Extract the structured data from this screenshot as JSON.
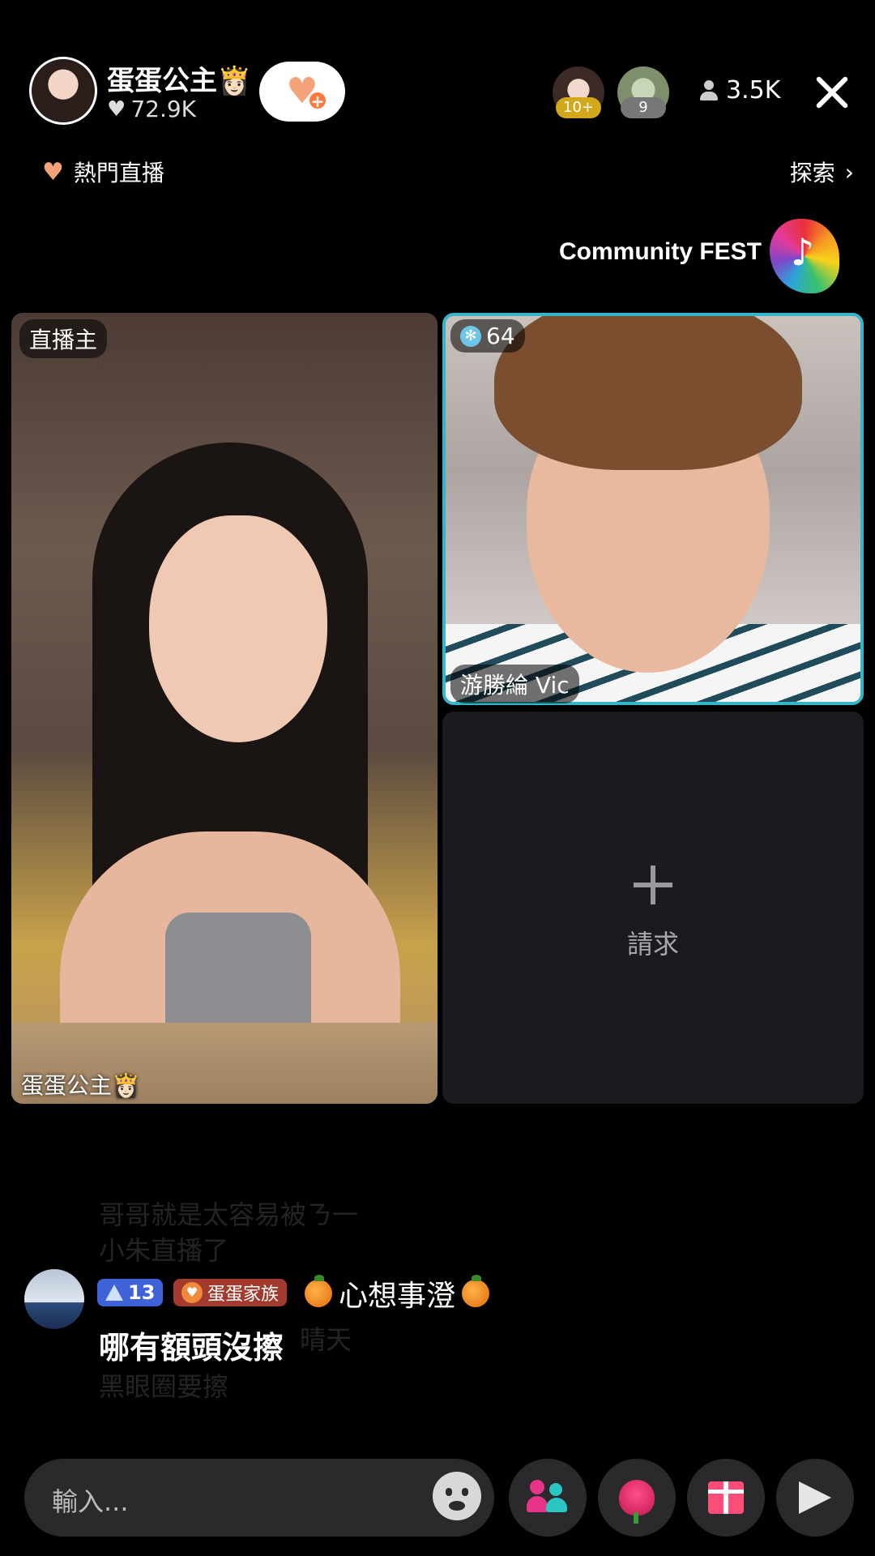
{
  "header": {
    "host_name": "蛋蛋公主👸🏻",
    "host_likes": "72.9K",
    "viewer_badges": [
      "10+",
      "9"
    ],
    "viewer_count": "3.5K"
  },
  "subbar": {
    "hot_live_label": "熱門直播",
    "explore_label": "探索"
  },
  "event_banner": {
    "title": "Community FEST"
  },
  "tiles": {
    "host_role": "直播主",
    "host_name": "蛋蛋公主👸🏻",
    "guest_score": "64",
    "guest_name": "游勝綸 Vic",
    "request_label": "請求"
  },
  "comments": {
    "faded": [
      "哥哥就是太容易被ㄋ一",
      "小朱直播了",
      "黑眼圈要擦",
      "晴天"
    ],
    "main": {
      "level": "13",
      "fan_club": "蛋蛋家族",
      "username": "心想事澄",
      "text": "哪有額頭沒擦"
    }
  },
  "bottom": {
    "input_placeholder": "輸入..."
  },
  "colors": {
    "accent_heart": "#f3a27a",
    "guest_border": "#37b5c8",
    "level_badge": "#3f62d8",
    "fan_badge": "#a23a2e"
  },
  "icons": [
    "heart-icon",
    "add-follow-icon",
    "person-icon",
    "close-icon",
    "chevron-right-icon",
    "snowflake-icon",
    "plus-icon",
    "emoji-icon",
    "guests-icon",
    "rose-icon",
    "gift-icon",
    "share-icon"
  ]
}
